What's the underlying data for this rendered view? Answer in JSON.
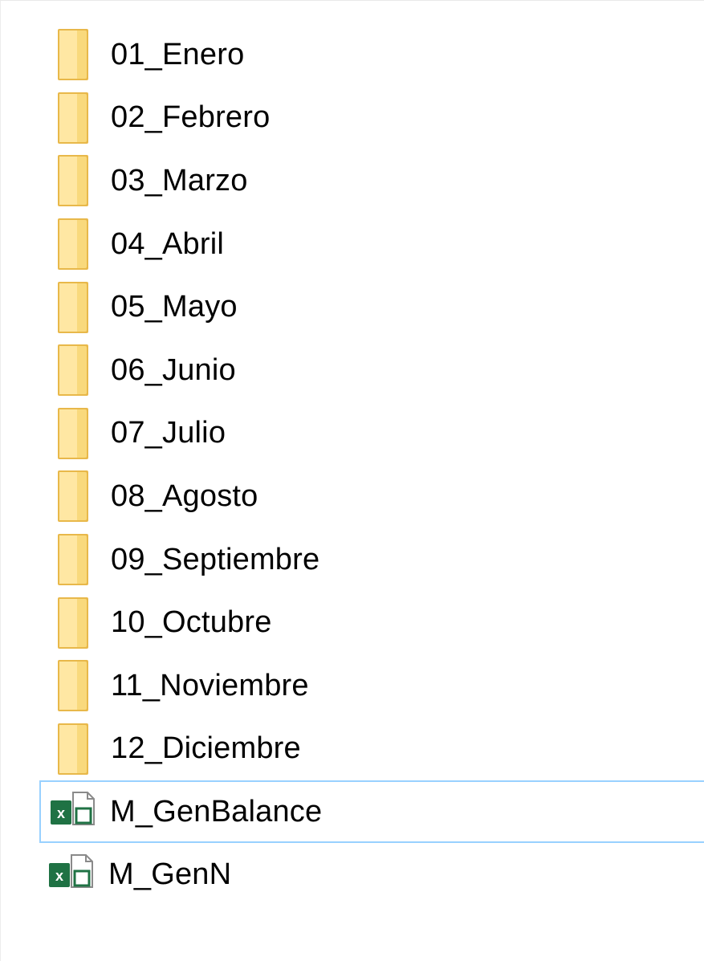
{
  "items": [
    {
      "name": "01_Enero",
      "type": "folder",
      "icon": "folder-icon"
    },
    {
      "name": "02_Febrero",
      "type": "folder",
      "icon": "folder-icon"
    },
    {
      "name": "03_Marzo",
      "type": "folder",
      "icon": "folder-icon"
    },
    {
      "name": "04_Abril",
      "type": "folder",
      "icon": "folder-icon"
    },
    {
      "name": "05_Mayo",
      "type": "folder",
      "icon": "folder-icon"
    },
    {
      "name": "06_Junio",
      "type": "folder",
      "icon": "folder-icon"
    },
    {
      "name": "07_Julio",
      "type": "folder",
      "icon": "folder-icon"
    },
    {
      "name": "08_Agosto",
      "type": "folder",
      "icon": "folder-icon"
    },
    {
      "name": "09_Septiembre",
      "type": "folder",
      "icon": "folder-icon"
    },
    {
      "name": "10_Octubre",
      "type": "folder",
      "icon": "folder-icon"
    },
    {
      "name": "11_Noviembre",
      "type": "folder",
      "icon": "folder-icon"
    },
    {
      "name": "12_Diciembre",
      "type": "folder",
      "icon": "folder-icon"
    },
    {
      "name": "M_GenBalance",
      "type": "excel",
      "icon": "excel-file-icon",
      "selected": true
    },
    {
      "name": "M_GenN",
      "type": "excel",
      "icon": "excel-file-icon"
    }
  ],
  "colors": {
    "folder_body": "#f8d775",
    "folder_front": "#ffe9a6",
    "selection_border": "#99d1ff",
    "excel_green": "#1f7244"
  }
}
